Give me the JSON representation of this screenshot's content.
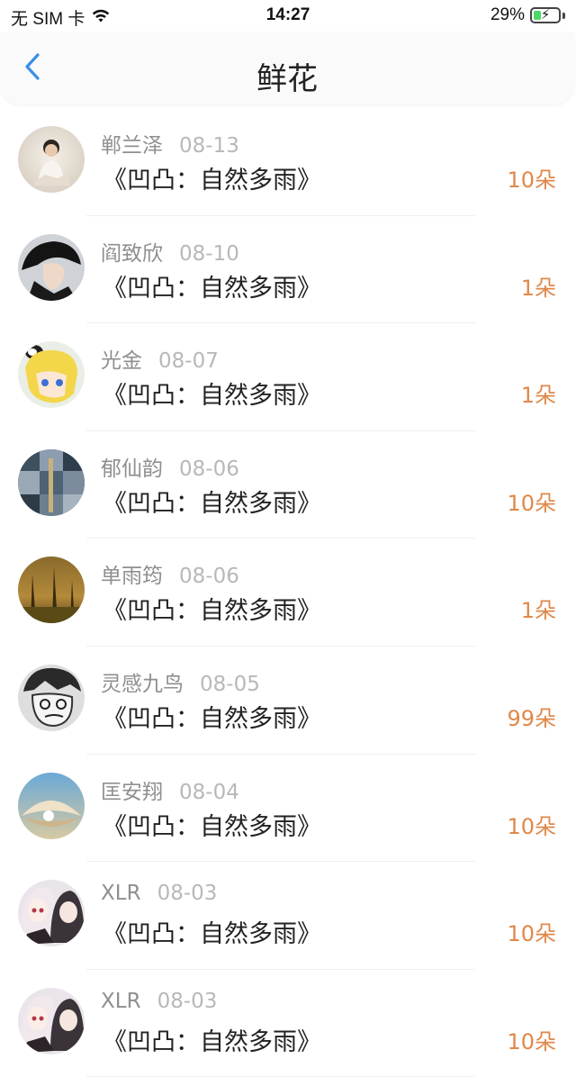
{
  "status_bar": {
    "carrier": "无 SIM 卡",
    "time": "14:27",
    "battery_percent": "29%",
    "battery_level": 0.29,
    "wifi_icon": "wifi-icon"
  },
  "nav": {
    "title": "鲜花",
    "back_icon": "chevron-left-icon"
  },
  "colors": {
    "accent": "#e0884a",
    "back": "#3a8ee6",
    "name": "#8f8f8f",
    "date": "#b8b8b8"
  },
  "items": [
    {
      "name": "郸兰泽",
      "date": "08-13",
      "title": "《凹凸：自然多雨》",
      "count": "10朵",
      "avatar": "avatar-person-white"
    },
    {
      "name": "阎致欣",
      "date": "08-10",
      "title": "《凹凸：自然多雨》",
      "count": "1朵",
      "avatar": "avatar-person-hat"
    },
    {
      "name": "光金",
      "date": "08-07",
      "title": "《凹凸：自然多雨》",
      "count": "1朵",
      "avatar": "avatar-anime-yellow"
    },
    {
      "name": "郁仙韵",
      "date": "08-06",
      "title": "《凹凸：自然多雨》",
      "count": "10朵",
      "avatar": "avatar-mosaic"
    },
    {
      "name": "单雨筠",
      "date": "08-06",
      "title": "《凹凸：自然多雨》",
      "count": "1朵",
      "avatar": "avatar-forest"
    },
    {
      "name": "灵感九鸟",
      "date": "08-05",
      "title": "《凹凸：自然多雨》",
      "count": "99朵",
      "avatar": "avatar-sketch-face"
    },
    {
      "name": "匡安翔",
      "date": "08-04",
      "title": "《凹凸：自然多雨》",
      "count": "10朵",
      "avatar": "avatar-shell"
    },
    {
      "name": "XLR",
      "date": "08-03",
      "title": "《凹凸：自然多雨》",
      "count": "10朵",
      "avatar": "avatar-anime-girls"
    },
    {
      "name": "XLR",
      "date": "08-03",
      "title": "《凹凸：自然多雨》",
      "count": "10朵",
      "avatar": "avatar-anime-girls"
    }
  ]
}
